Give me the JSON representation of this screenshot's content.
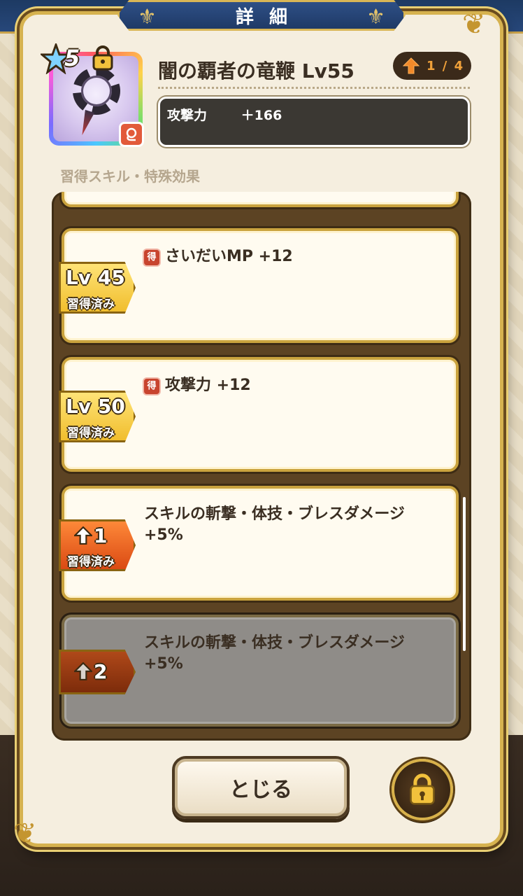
{
  "dialog": {
    "title": "詳細",
    "close_label": "とじる"
  },
  "item": {
    "name": "闇の覇者の竜鞭 Lv55",
    "stars": "5",
    "rank": "1 / 4",
    "type_icon": "whip-icon",
    "stat_label": "攻撃力",
    "stat_value": "＋166"
  },
  "skills_section": {
    "label": "習得スキル・特殊効果",
    "items": [
      {
        "tag_main": "Lv 45",
        "tag_sub": "習得済み",
        "get_mark": "得",
        "text": "さいだいMP +12",
        "locked": false
      },
      {
        "tag_main": "Lv 50",
        "tag_sub": "習得済み",
        "get_mark": "得",
        "text": "攻撃力 +12",
        "locked": false
      },
      {
        "tag_main": "1",
        "tag_sub": "習得済み",
        "text": "スキルの斬撃・体技・ブレスダメージ +5%",
        "locked": false
      },
      {
        "tag_main": "2",
        "text": "スキルの斬撃・体技・ブレスダメージ +5%",
        "locked": true
      }
    ]
  },
  "colors": {
    "frame_gold": "#d6b24f",
    "title_blue": "#2e4f86",
    "rank_orange": "#f0a13a",
    "get_mark_red": "#c8442e"
  }
}
